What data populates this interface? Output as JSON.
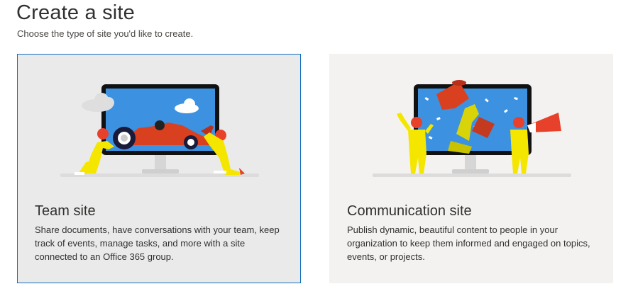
{
  "page": {
    "title": "Create a site",
    "subtitle": "Choose the type of site you'd like to create."
  },
  "cards": [
    {
      "id": "team",
      "title": "Team site",
      "description": "Share documents, have conversations with your team, keep track of events, manage tasks, and more with a site connected to an Office 365 group.",
      "selected": true
    },
    {
      "id": "communication",
      "title": "Communication site",
      "description": "Publish dynamic, beautiful content to people in your organization to keep them informed and engaged on topics, events, or projects.",
      "selected": false
    }
  ],
  "colors": {
    "selected_border": "#106ebe",
    "screen_blue": "#3c92e0",
    "figure_yellow": "#f5e600",
    "helmet_red": "#e8412b"
  }
}
